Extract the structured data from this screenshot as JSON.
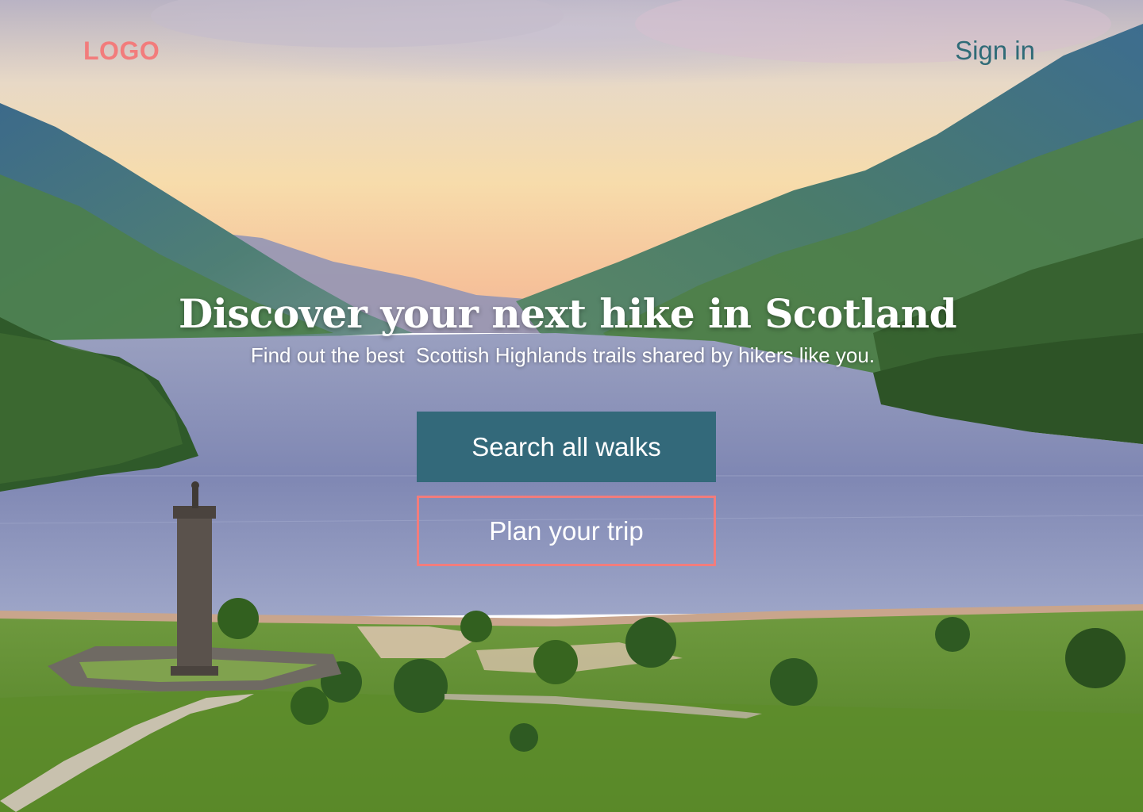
{
  "header": {
    "logo": "LOGO",
    "sign_in": "Sign in"
  },
  "hero": {
    "title": "Discover your next hike in Scotland",
    "subtitle": "Find out the best  Scottish Highlands trails shared by hikers like you.",
    "primary_button": "Search all walks",
    "secondary_button": "Plan your trip"
  },
  "colors": {
    "accent_coral": "#f27c7c",
    "brand_teal": "#33697a",
    "sign_in_teal": "#2f6b77"
  },
  "icons": {
    "background": "loch-landscape-photo"
  }
}
